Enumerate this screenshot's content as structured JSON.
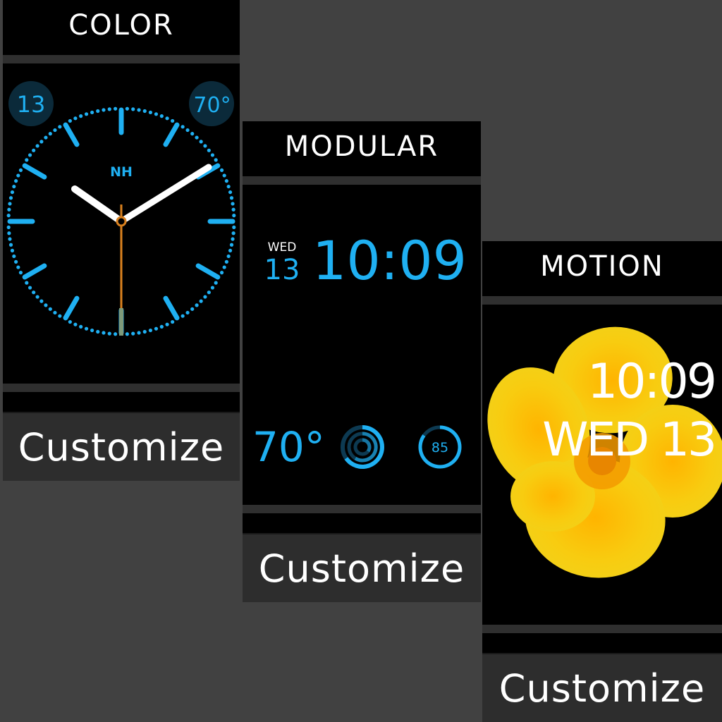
{
  "faces": {
    "color": {
      "title": "COLOR",
      "date_complication": "13",
      "temp_complication": "70°",
      "monogram": "NH",
      "customize_label": "Customize",
      "accent": "#1fb0f2"
    },
    "modular": {
      "title": "MODULAR",
      "day": "WED",
      "date": "13",
      "time": "10:09",
      "temperature": "70°",
      "battery": "85",
      "customize_label": "Customize",
      "accent": "#1fb0f2"
    },
    "motion": {
      "title": "MOTION",
      "time": "10:09",
      "date": "WED 13",
      "customize_label": "Customize",
      "flower_color": "#f9c80e"
    }
  }
}
